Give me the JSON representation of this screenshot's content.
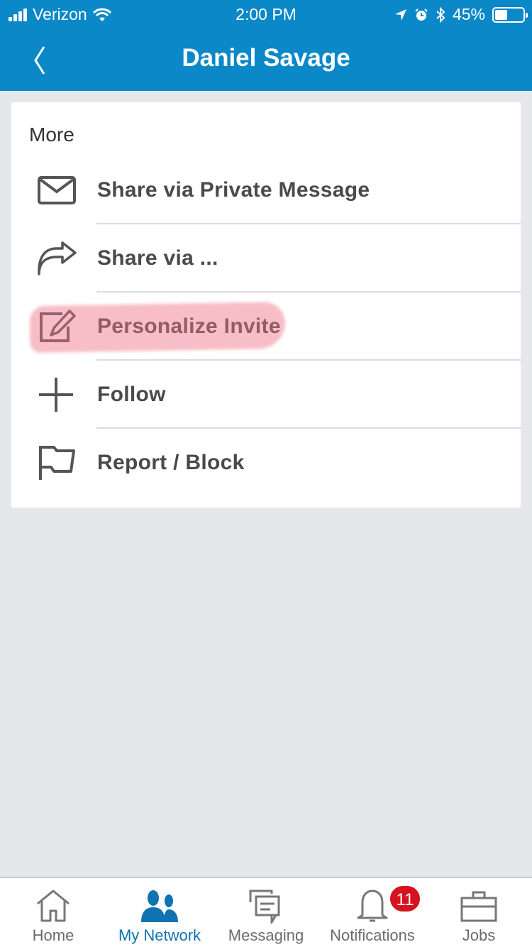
{
  "status_bar": {
    "carrier": "Verizon",
    "time": "2:00 PM",
    "battery_percent": "45%",
    "battery_level": 0.45,
    "icons": [
      "signal-icon",
      "wifi-icon",
      "location-icon",
      "alarm-icon",
      "bluetooth-icon",
      "battery-icon"
    ]
  },
  "header": {
    "title": "Daniel Savage",
    "back_icon": "chevron-left-icon"
  },
  "card": {
    "heading": "More",
    "items": [
      {
        "label": "Share via Private Message",
        "icon": "envelope-icon"
      },
      {
        "label": "Share via ...",
        "icon": "share-arrow-icon"
      },
      {
        "label": "Personalize Invite",
        "icon": "edit-icon",
        "highlighted": true
      },
      {
        "label": "Follow",
        "icon": "plus-icon"
      },
      {
        "label": "Report / Block",
        "icon": "flag-icon"
      }
    ]
  },
  "tabbar": {
    "tabs": [
      {
        "label": "Home",
        "icon": "home-icon"
      },
      {
        "label": "My Network",
        "icon": "people-icon",
        "active": true
      },
      {
        "label": "Messaging",
        "icon": "messaging-icon"
      },
      {
        "label": "Notifications",
        "icon": "bell-icon",
        "badge": "11"
      },
      {
        "label": "Jobs",
        "icon": "briefcase-icon"
      }
    ]
  },
  "colors": {
    "brand": "#0a88c8",
    "active_tab": "#0e73b0",
    "badge": "#d6121f",
    "highlight": "#f06e82"
  }
}
